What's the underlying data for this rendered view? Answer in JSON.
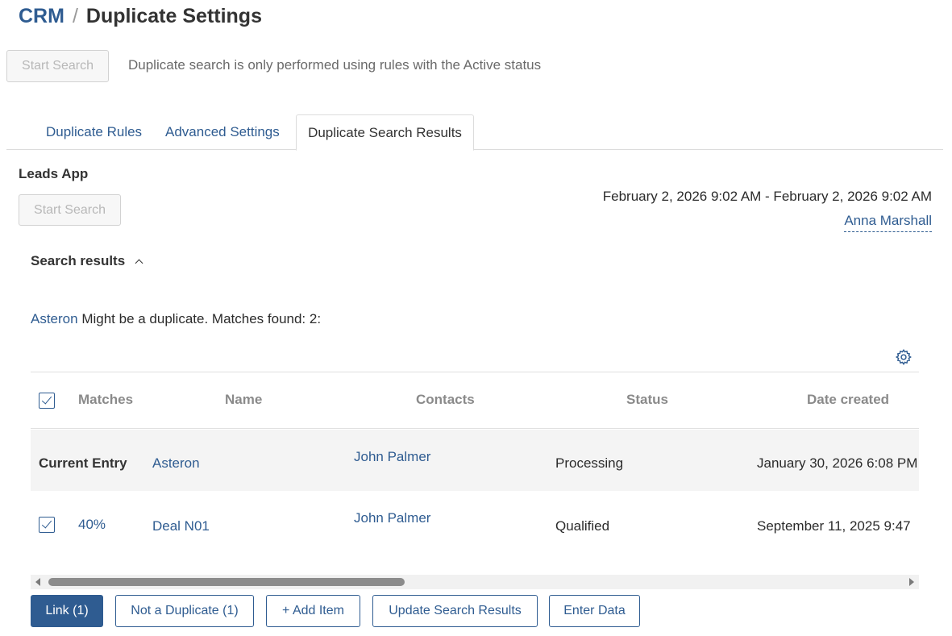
{
  "breadcrumb": {
    "root": "CRM",
    "separator": "/",
    "title": "Duplicate Settings"
  },
  "top": {
    "start_search_label": "Start Search",
    "note": "Duplicate search is only performed using rules with the Active status"
  },
  "tabs": [
    {
      "label": "Duplicate Rules"
    },
    {
      "label": "Advanced Settings"
    },
    {
      "label": "Duplicate Search Results",
      "active": true
    }
  ],
  "section": {
    "title": "Leads App",
    "start_search_label": "Start Search",
    "date_range": "February 2, 2026 9:02 AM - February 2, 2026 9:02 AM",
    "user": "Anna Marshall"
  },
  "results": {
    "header": "Search results",
    "entry_link": "Asteron",
    "summary": " Might be a duplicate. Matches found: 2:"
  },
  "table": {
    "columns": [
      "Matches",
      "Name",
      "Contacts",
      "Status",
      "Date created"
    ],
    "current": {
      "label": "Current Entry",
      "name": "Asteron",
      "contact": "John Palmer",
      "status": "Processing",
      "date": "January 30, 2026 6:08 PM"
    },
    "rows": [
      {
        "match": "40%",
        "name": "Deal N01",
        "contact": "John Palmer",
        "status": "Qualified",
        "date": "September 11, 2025 9:47"
      }
    ]
  },
  "actions": {
    "link": "Link (1)",
    "not_duplicate": "Not a Duplicate (1)",
    "add_item": "+ Add Item",
    "update": "Update Search Results",
    "enter_data": "Enter Data"
  },
  "colors": {
    "accent": "#2f5c91",
    "border": "#dcdcdc",
    "row_highlight": "#f4f4f4"
  },
  "icons": {
    "settings": "gear-icon",
    "collapse": "chevron-up-icon",
    "checkbox": "checkbox-checked-icon"
  }
}
